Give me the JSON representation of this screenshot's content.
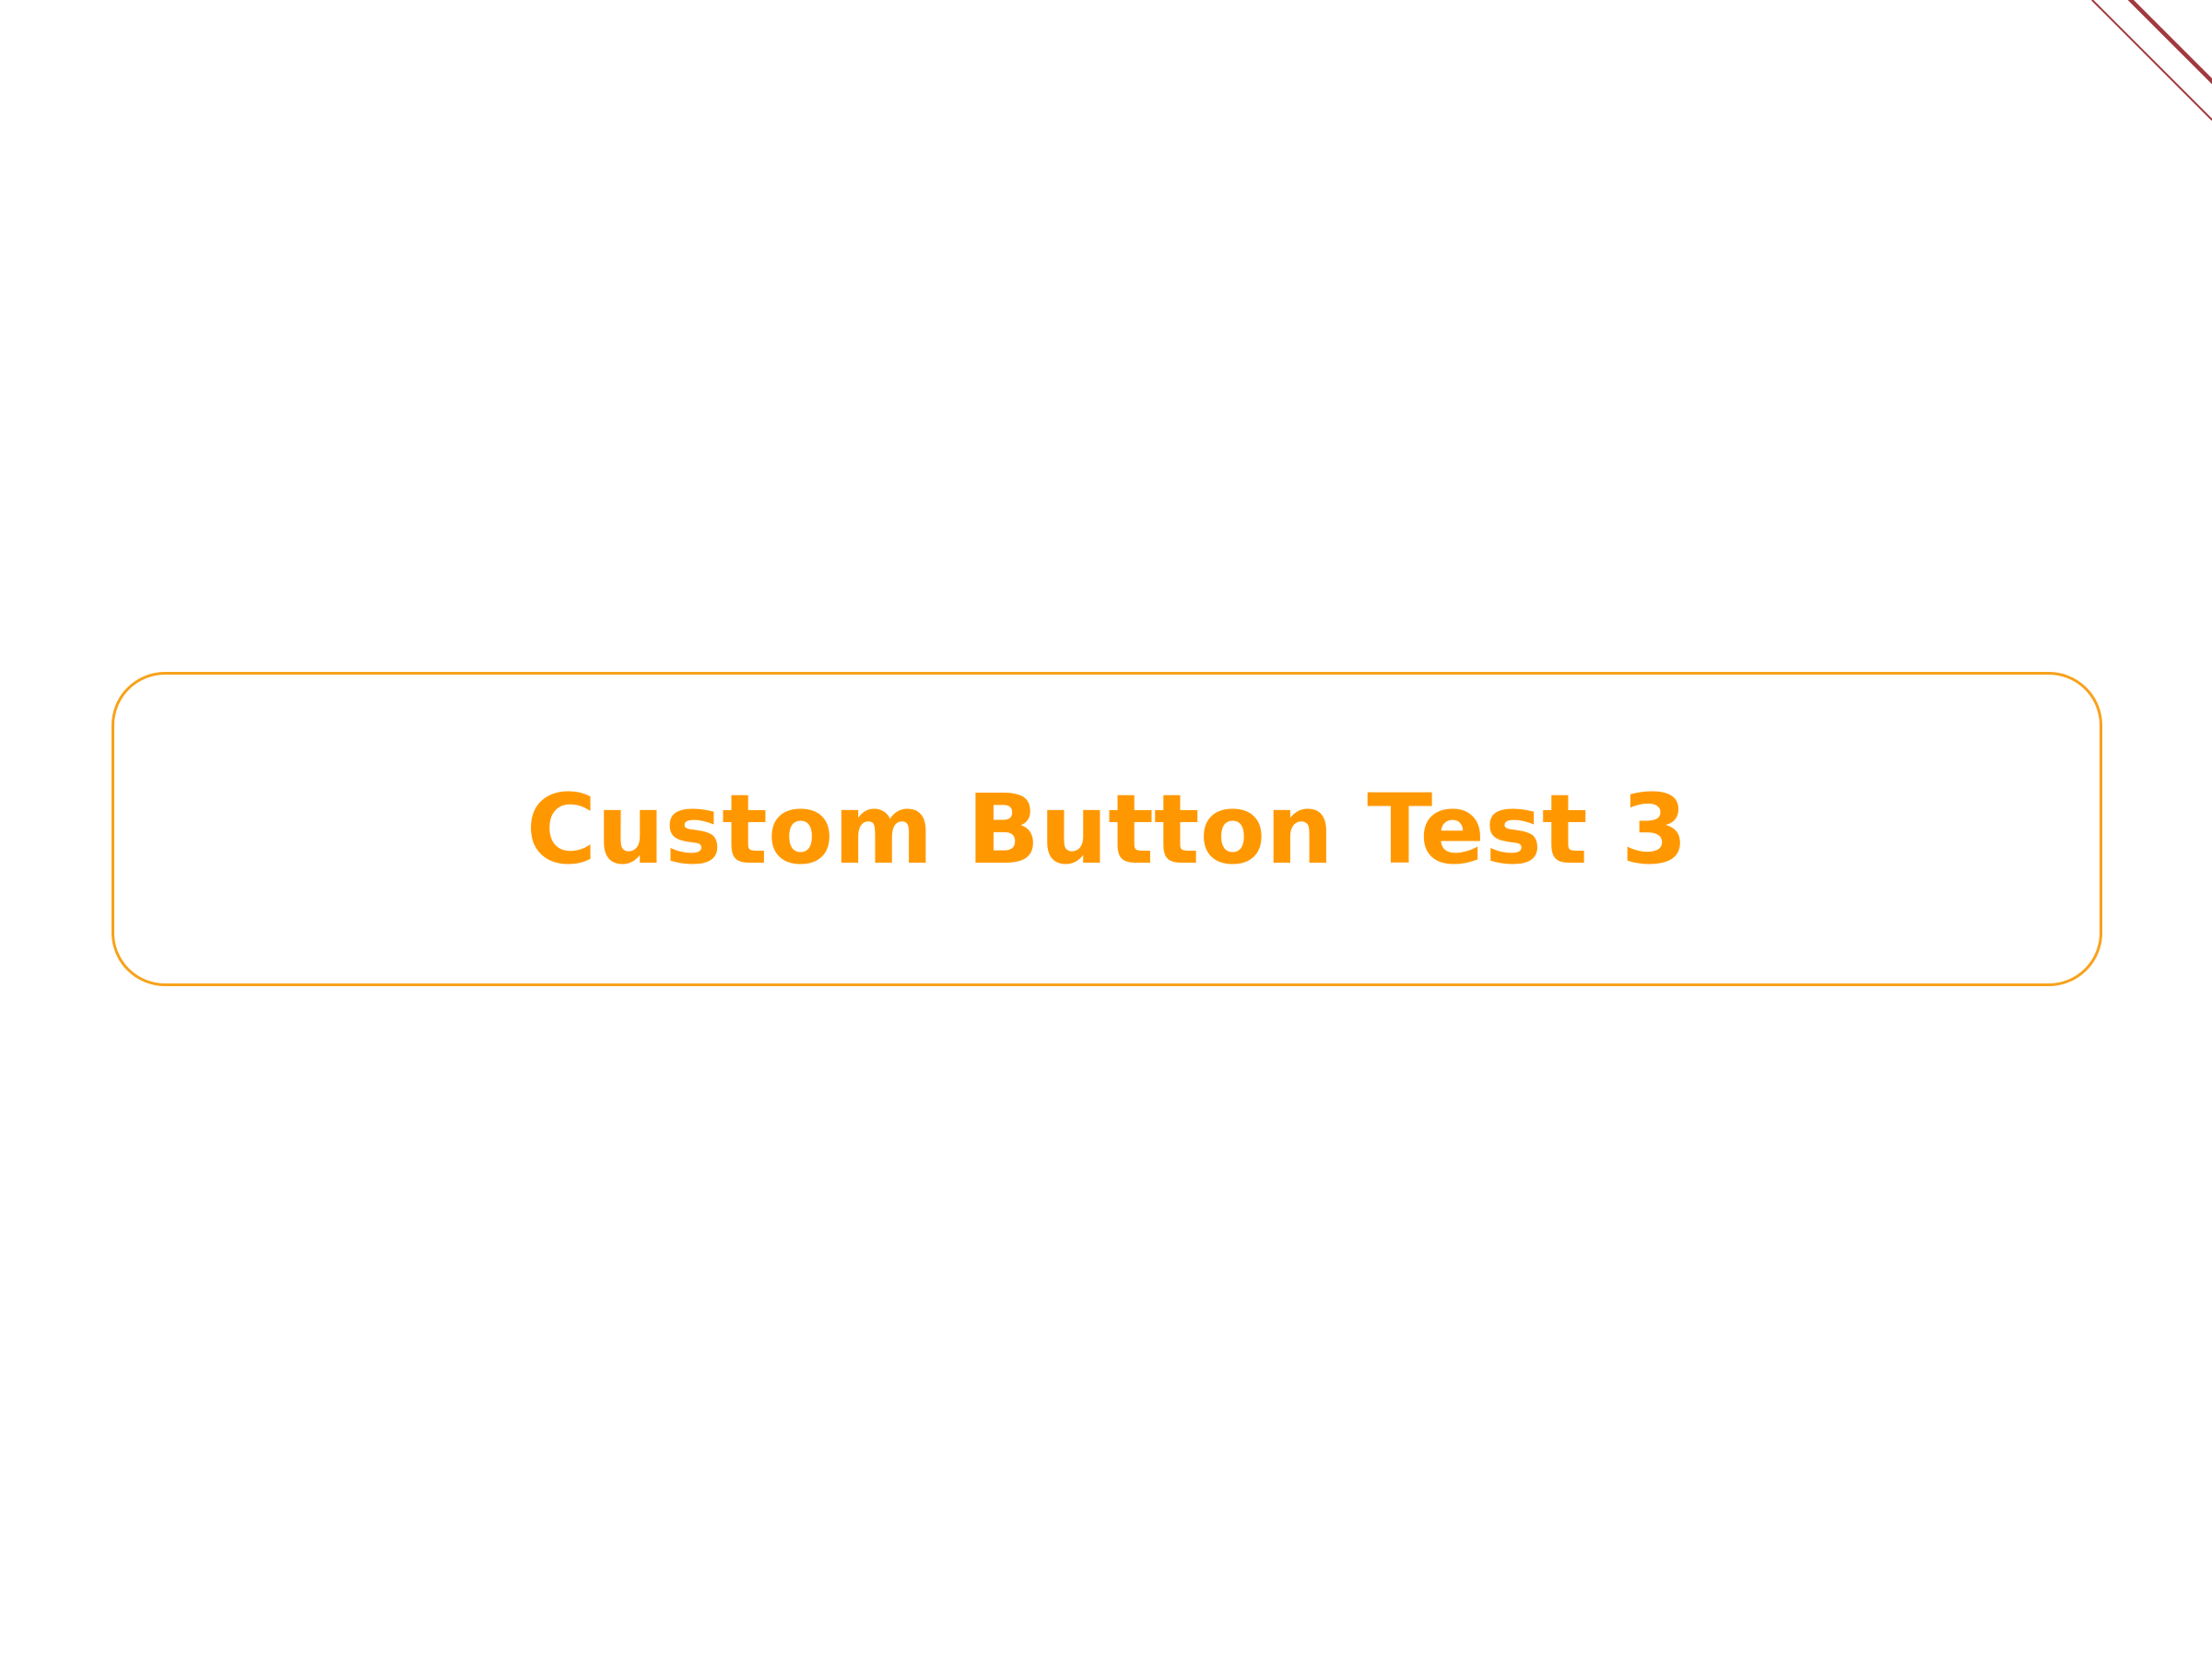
{
  "main": {
    "button_label": "Custom Button Test 3"
  },
  "colors": {
    "button_border": "#F7A21B",
    "button_text": "#FF9800",
    "background": "#FFFFFF",
    "corner_banner": "#A0393F"
  },
  "corner_banner": {
    "icon": "debug-ribbon-icon"
  }
}
